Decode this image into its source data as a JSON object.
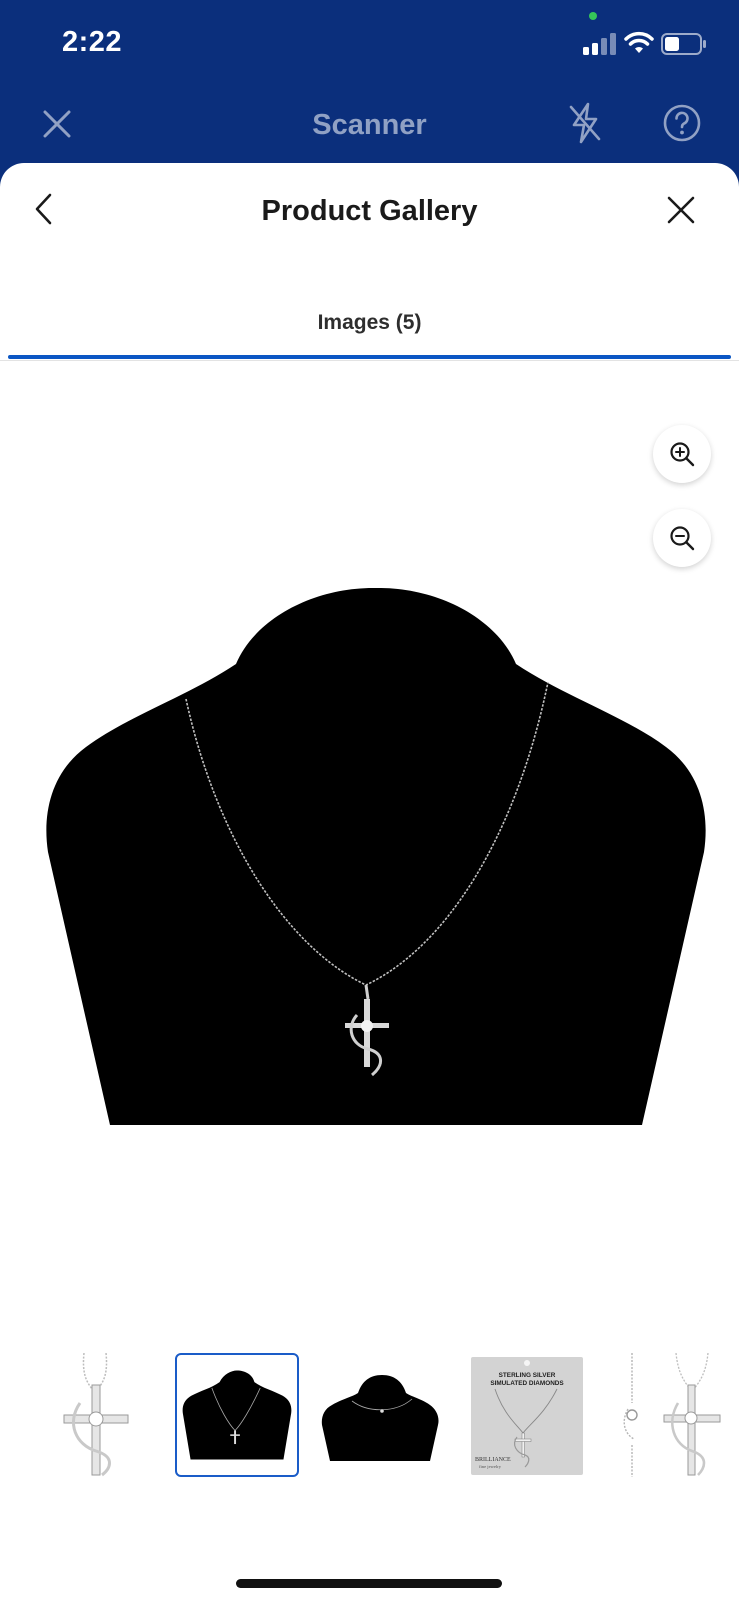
{
  "status_bar": {
    "time": "2:22"
  },
  "scanner": {
    "title": "Scanner",
    "icons": [
      "close-icon",
      "flash-off-icon",
      "help-icon"
    ]
  },
  "gallery": {
    "title": "Product Gallery",
    "tab_label": "Images (5)",
    "selected_index": 2,
    "zoom_in_icon": "zoom-in-icon",
    "zoom_out_icon": "zoom-out-icon",
    "thumbnails": [
      {
        "desc": "cross pendant closeup"
      },
      {
        "desc": "necklace on black bust"
      },
      {
        "desc": "necklace on black bust, side view"
      },
      {
        "desc": "packaging card",
        "card_line1": "STERLING SILVER",
        "card_line2": "SIMULATED DIAMONDS",
        "card_brand": "BRILLIANCE",
        "card_brand_sub": "fine jewelry"
      },
      {
        "desc": "clasp and pendant detail"
      }
    ]
  },
  "colors": {
    "brand_blue": "#0b2f7c",
    "accent_blue": "#0b56c4"
  }
}
